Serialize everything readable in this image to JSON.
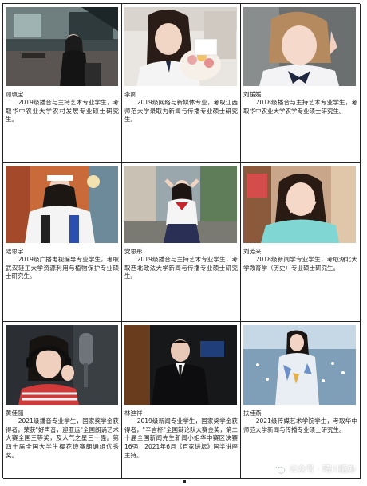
{
  "profiles": [
    {
      "name": "顾珮宝",
      "bio": "2019级播音与主持艺术专业学生，考取华中农业大学农村发展专业硕士研究生。"
    },
    {
      "name": "李卿",
      "bio": "2019级网络与新媒体专业，考取江西师范大学录取为新闻与传播专业硕士研究生。"
    },
    {
      "name": "刘媛媛",
      "bio": "2018级播音与主持艺术专业学生，考取华中农业大学农学专业硕士研究生。"
    },
    {
      "name": "陆思宇",
      "bio": "2019级广播电视编导专业学生，考取武汉轻工大学资源利用与植物保护专业硕士研究生。"
    },
    {
      "name": "党思彤",
      "bio": "2019级播音与主持艺术专业学生，考取西北政法大学新闻与传播专业硕士研究生。"
    },
    {
      "name": "刘芳来",
      "bio": "2018级新闻学专业学生，考取湖北大学教育学（历史）专业硕士研究生。"
    },
    {
      "name": "黄佳丽",
      "bio": "2021级播音专业学生，国家奖学金获得者，荣获\"好声音，迎亚运\"全国朗诵艺术大赛全国三等奖，及人气之星三十强。第四十届全国大学生樱花诗赛朗诵组优秀奖。"
    },
    {
      "name": "林迪祥",
      "bio": "2019级新闻专业学生，国家奖学金获得者，\"辛言杯\"全国辩论队大赛金奖，第二十届全国新闻先生新闻小姐华中赛区决赛16强，2021年6月《百家讲坛》国学讲座主持。"
    },
    {
      "name": "扶佳燕",
      "bio": "2021级传媒艺术学院学生，考取华中师范大学新闻与传播专业硕士研究生。"
    }
  ],
  "watermark": {
    "text": "公众号 · 晴川招办",
    "icon": "wechat-icon"
  },
  "colors": {
    "border": "#222222",
    "text": "#222222"
  }
}
